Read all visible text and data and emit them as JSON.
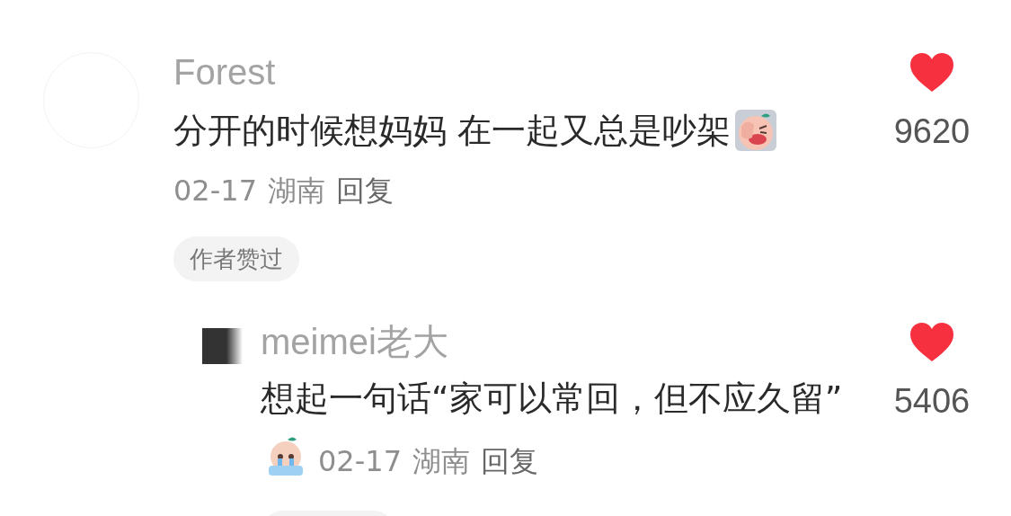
{
  "comments": [
    {
      "author": "Forest",
      "text": "分开的时候想妈妈 在一起又总是吵架",
      "date": "02-17",
      "location": "湖南",
      "reply": "回复",
      "badge": "作者赞过",
      "liked": true,
      "likes": "9620",
      "replies": [
        {
          "author": "meimei老大",
          "text": "想起一句话“家可以常回，但不应久留”",
          "date": "02-17",
          "location": "湖南",
          "reply": "回复",
          "liked": true,
          "likes": "5406",
          "badge_cut": true
        }
      ]
    }
  ]
}
